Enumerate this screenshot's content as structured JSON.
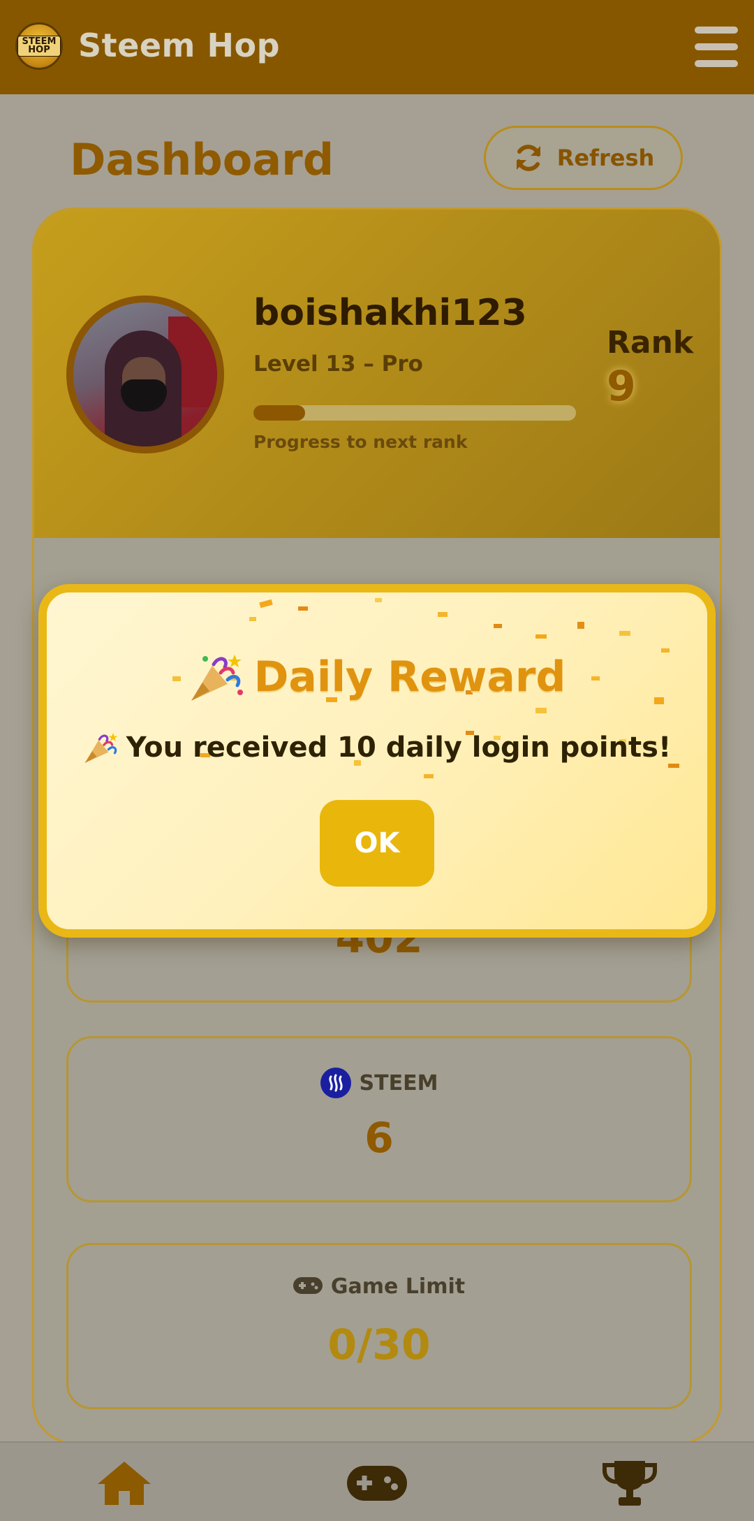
{
  "header": {
    "app_title": "Steem Hop",
    "logo_text": "STEEM HOP",
    "logo_icon": "steem-hop-logo",
    "menu_icon": "hamburger-menu-icon"
  },
  "dashboard": {
    "title": "Dashboard",
    "refresh_label": "Refresh",
    "refresh_icon": "refresh-icon"
  },
  "profile": {
    "username": "boishakhi123",
    "level": "Level 13 – Pro",
    "progress_fraction": 0.16,
    "progress_label": "Progress to next rank",
    "rank_label": "Rank",
    "rank_value": "9"
  },
  "stats": [
    {
      "name": "",
      "value": "402",
      "color": "#8f5a00"
    },
    {
      "name": "STEEM",
      "value": "6",
      "icon": "steem-icon",
      "color": "#8f5a00"
    },
    {
      "name": "Game Limit",
      "value": "0/30",
      "icon": "gamepad-icon",
      "color": "#b28a10"
    }
  ],
  "modal": {
    "title": "Daily Reward",
    "message": "You received 10 daily login points!",
    "ok_label": "OK",
    "icon": "party-popper-icon"
  },
  "bottom_nav": {
    "items": [
      "home-icon",
      "gamepad-icon",
      "trophy-icon"
    ]
  },
  "colors": {
    "header_bg": "#875700",
    "accent": "#e9b816",
    "brand_dark": "#8f5a00"
  }
}
